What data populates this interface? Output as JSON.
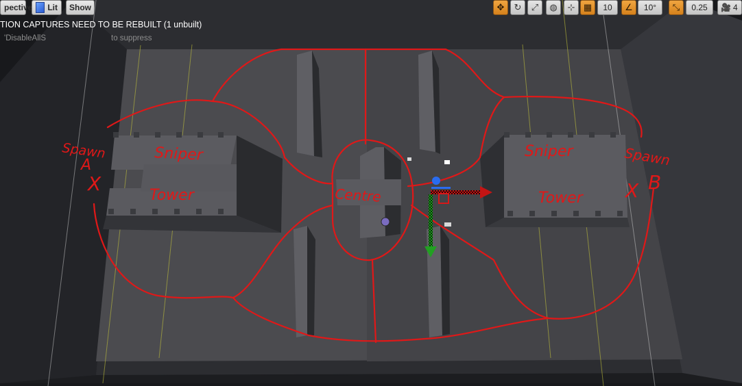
{
  "toolbar": {
    "perspective_label": "pective",
    "lit_label": "Lit",
    "show_label": "Show",
    "grid_snap_value": "10",
    "rotation_snap_value": "10°",
    "scale_snap_value": "0.25",
    "camera_speed_value": "4",
    "icons": [
      "cube-icon",
      "translate-icon",
      "rotate-icon",
      "world-icon",
      "surface-snap-icon",
      "grid-icon",
      "angle-icon",
      "scale-icon",
      "camera-speed-icon"
    ]
  },
  "viewport_messages": {
    "warning": "TION CAPTURES NEED TO BE REBUILT (1 unbuilt)",
    "hint": "'DisableAllS",
    "hint_rest": "to suppress"
  },
  "annotations": {
    "spawn_a": "Spawn",
    "spawn_a_letter": "A",
    "spawn_a_mark": "X",
    "sniper_left": "Sniper",
    "tower_left": "Tower",
    "centre": "Centre",
    "sniper_right": "Sniper",
    "tower_right": "Tower",
    "spawn_b": "Spawn",
    "spawn_b_mark": "X",
    "spawn_b_letter": "B"
  },
  "colors": {
    "annotation_red": "#e01818",
    "toolbar_orange": "#e3922a",
    "gizmo_x": "#d81818",
    "gizmo_y": "#2aa12a",
    "gizmo_z": "#2a6cf0"
  }
}
